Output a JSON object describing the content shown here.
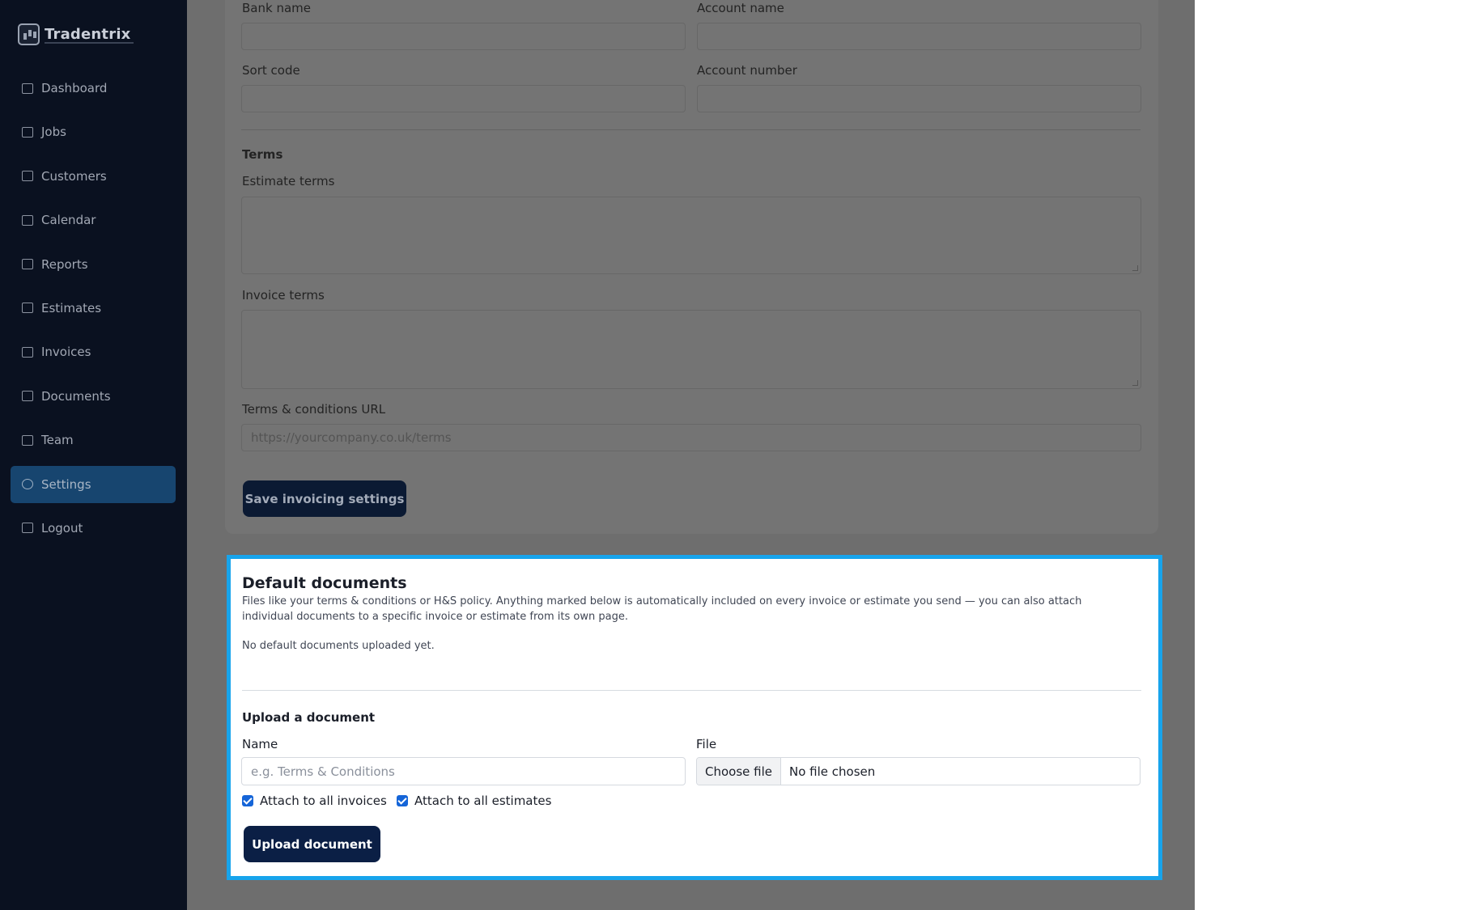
{
  "app": {
    "name": "Tradentrix"
  },
  "sidebar": {
    "items": [
      {
        "label": "Dashboard",
        "icon": "dashboard-icon"
      },
      {
        "label": "Jobs",
        "icon": "briefcase-icon"
      },
      {
        "label": "Customers",
        "icon": "users-icon"
      },
      {
        "label": "Calendar",
        "icon": "calendar-icon"
      },
      {
        "label": "Reports",
        "icon": "bar-chart-icon"
      },
      {
        "label": "Estimates",
        "icon": "file-icon"
      },
      {
        "label": "Invoices",
        "icon": "list-icon"
      },
      {
        "label": "Documents",
        "icon": "folder-icon"
      },
      {
        "label": "Team",
        "icon": "team-icon"
      },
      {
        "label": "Settings",
        "icon": "gear-icon",
        "active": true
      },
      {
        "label": "Logout",
        "icon": "logout-icon"
      }
    ]
  },
  "bank": {
    "bank_name_label": "Bank name",
    "bank_name_value": "",
    "account_name_label": "Account name",
    "account_name_value": "",
    "sort_code_label": "Sort code",
    "sort_code_value": "",
    "account_number_label": "Account number",
    "account_number_value": ""
  },
  "terms": {
    "heading": "Terms",
    "estimate_label": "Estimate terms",
    "estimate_value": "",
    "invoice_label": "Invoice terms",
    "invoice_value": "",
    "url_label": "Terms & conditions URL",
    "url_placeholder": "https://yourcompany.co.uk/terms",
    "save_button": "Save invoicing settings"
  },
  "default_documents": {
    "title": "Default documents",
    "description": "Files like your terms & conditions or H&S policy. Anything marked below is automatically included on every invoice or estimate you send — you can also attach individual documents to a specific invoice or estimate from its own page.",
    "empty_text": "No default documents uploaded yet.",
    "upload_heading": "Upload a document",
    "name_label": "Name",
    "name_placeholder": "e.g. Terms & Conditions",
    "file_label": "File",
    "file_button": "Choose file",
    "file_status": "No file chosen",
    "attach_invoices_label": "Attach to all invoices",
    "attach_invoices_checked": true,
    "attach_estimates_label": "Attach to all estimates",
    "attach_estimates_checked": true,
    "upload_button": "Upload document"
  },
  "colors": {
    "sidebar_bg": "#0a1120",
    "active_item": "#17456f",
    "highlight_border": "#17a4ec",
    "primary_button": "#0b1f45",
    "checkbox": "#1565d8"
  }
}
